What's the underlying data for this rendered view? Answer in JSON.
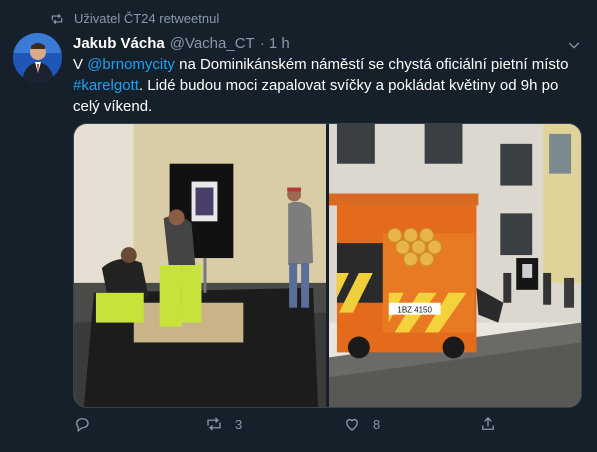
{
  "retweet": {
    "text": "Uživatel ČT24 retweetnul",
    "icon": "retweet-icon"
  },
  "author": {
    "name": "Jakub Vácha",
    "handle": "@Vacha_CT",
    "time": "· 1 h"
  },
  "tweet": {
    "prefix": "V ",
    "mention": "@brnomycity",
    "middle": " na Dominikánském náměstí se chystá oficiální pietní místo ",
    "hashtag": "#karelgott",
    "suffix": ". Lidé budou moci zapalovat svíčky a pokládat květiny od 9h po celý víkend."
  },
  "media": {
    "van_plate": "1BZ 4150"
  },
  "actions": {
    "reply_count": "",
    "retweet_count": "3",
    "like_count": "8"
  },
  "colors": {
    "background": "#15202b",
    "link": "#1da1f2",
    "secondary": "#8899a6"
  }
}
